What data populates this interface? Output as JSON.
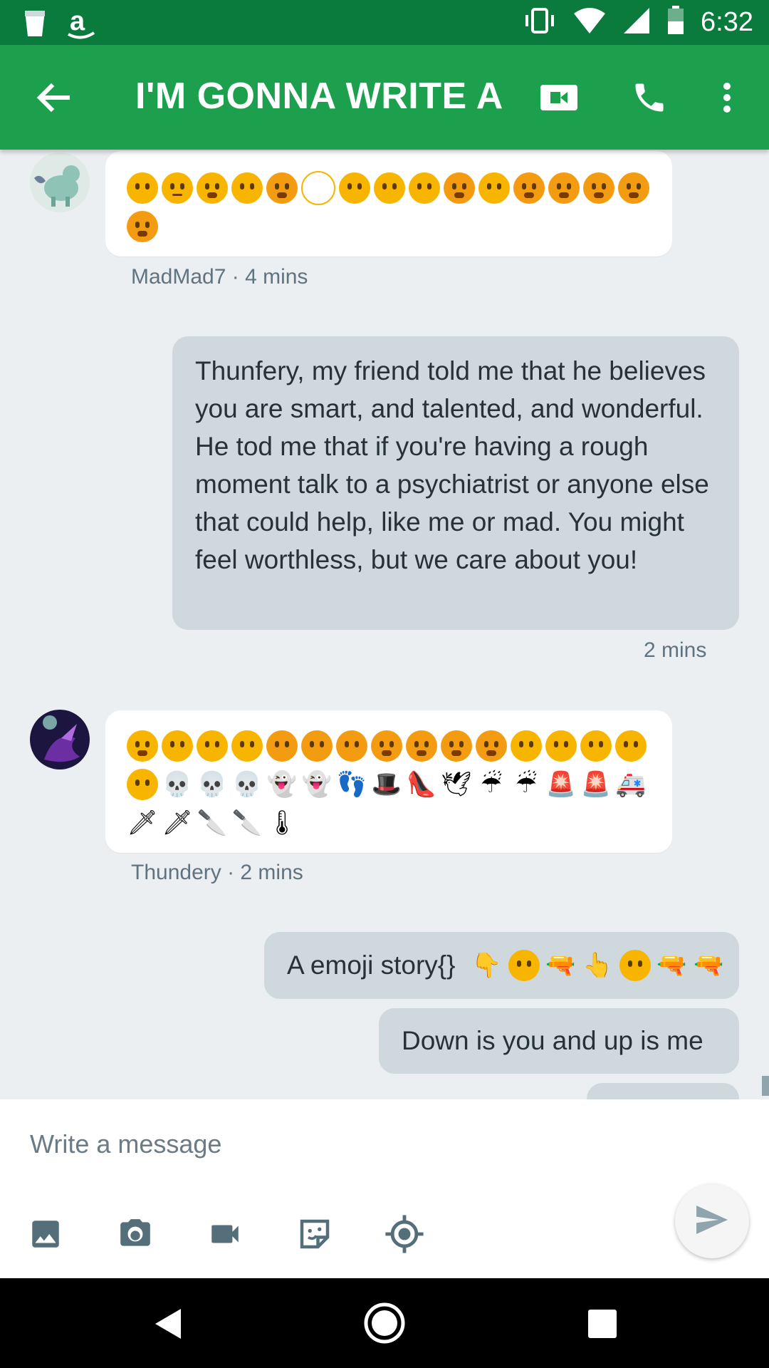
{
  "status_bar": {
    "time": "6:32",
    "icons": [
      "cup-icon",
      "amazon-icon",
      "vibrate-icon",
      "wifi-icon",
      "signal-icon",
      "battery-icon"
    ]
  },
  "app_bar": {
    "title": "I'M GONNA WRITE A...",
    "icons": [
      "back-arrow-icon",
      "video-call-icon",
      "phone-icon",
      "more-vert-icon"
    ],
    "color": "#1ca04d"
  },
  "messages": [
    {
      "sender": "MadMad7",
      "time_label": "MadMad7 · 4 mins",
      "emoji_rows": [
        15,
        1
      ]
    },
    {
      "from_me": true,
      "text": "Thunfery, my friend told me that he believes you are smart, and talented, and wonderful. He tod me that if you're having a rough moment talk to a psychiatrist or anyone else that could help, like me or mad. You might feel worthless, but we care about you!",
      "time_label": "2 mins"
    },
    {
      "sender": "Thundery",
      "time_label": "Thundery · 2 mins",
      "emoji_rows": [
        15,
        15,
        5
      ]
    },
    {
      "from_me": true,
      "text": "A emoji story{}"
    },
    {
      "from_me": true,
      "text": "Down is you and up is me"
    }
  ],
  "composer": {
    "placeholder": "Write a message",
    "tools": [
      "image-icon",
      "camera-icon",
      "video-icon",
      "sticker-icon",
      "location-icon"
    ],
    "send_icon": "send-icon"
  },
  "nav_bar": {
    "icons": [
      "back-triangle-icon",
      "home-circle-icon",
      "recents-square-icon"
    ]
  }
}
